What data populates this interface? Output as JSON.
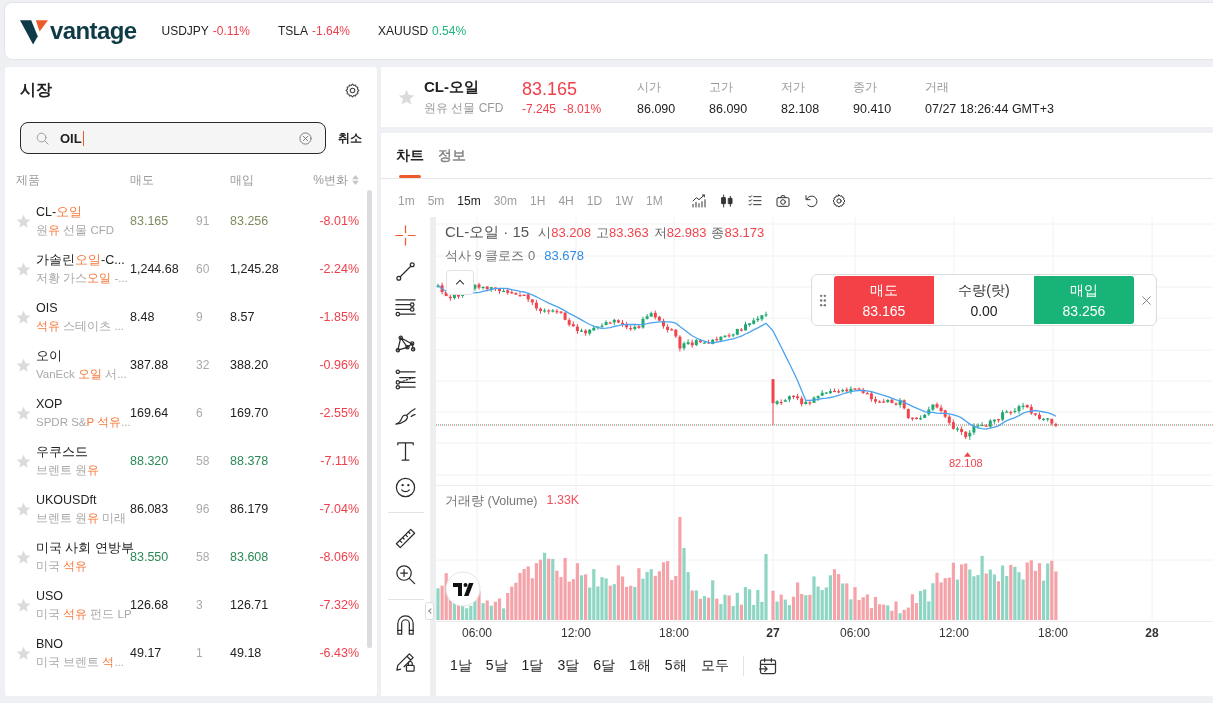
{
  "top_bar": {
    "logo": "vantage",
    "tickers": [
      {
        "symbol": "USDJPY",
        "change": "-0.11%",
        "falling": true
      },
      {
        "symbol": "TSLA",
        "change": "-1.64%",
        "falling": true
      },
      {
        "symbol": "XAUUSD",
        "change": "0.54%",
        "falling": false
      }
    ]
  },
  "market": {
    "title": "시장",
    "search": {
      "value": "OIL",
      "focused": true
    },
    "cancel": "취소",
    "columns": [
      {
        "label": "제품",
        "sortable": false
      },
      {
        "label": "매도",
        "sortable": false
      },
      {
        "label": "매입",
        "sortable": false
      },
      {
        "label": "%변화",
        "sortable": true
      }
    ],
    "rows": [
      {
        "symbol": [
          {
            "text": "CL-",
            "match": false
          },
          {
            "text": "오일",
            "match": true
          }
        ],
        "description": [
          {
            "text": "원",
            "match": false
          },
          {
            "text": "유",
            "match": true
          },
          {
            "text": " 선물 CFD",
            "match": false
          }
        ],
        "favorite": false,
        "bid": "83.165",
        "spread": "91",
        "ask": "83.256",
        "change": "-8.01%",
        "falling": true,
        "color": "#7d8c5e"
      },
      {
        "symbol": [
          {
            "text": "가솔린",
            "match": false
          },
          {
            "text": "오일",
            "match": true
          },
          {
            "text": "-C...",
            "match": false
          }
        ],
        "description": [
          {
            "text": "저황 가스",
            "match": false
          },
          {
            "text": "오일",
            "match": true
          },
          {
            "text": " -...",
            "match": false
          }
        ],
        "favorite": false,
        "bid": "1,244.68",
        "spread": "60",
        "ask": "1,245.28",
        "change": "-2.24%",
        "falling": true,
        "color": "#222222"
      },
      {
        "symbol": [
          {
            "text": "OIS",
            "match": false
          }
        ],
        "description": [
          {
            "text": "석유",
            "match": true
          },
          {
            "text": " 스테이츠 ...",
            "match": false
          }
        ],
        "favorite": false,
        "bid": "8.48",
        "spread": "9",
        "ask": "8.57",
        "change": "-1.85%",
        "falling": true,
        "color": "#222222"
      },
      {
        "symbol": [
          {
            "text": "오이",
            "match": false
          }
        ],
        "description": [
          {
            "text": "VanEck ",
            "match": false
          },
          {
            "text": "오일",
            "match": true
          },
          {
            "text": " 서...",
            "match": false
          }
        ],
        "favorite": false,
        "bid": "387.88",
        "spread": "32",
        "ask": "388.20",
        "change": "-0.96%",
        "falling": true,
        "color": "#222222"
      },
      {
        "symbol": [
          {
            "text": "XOP",
            "match": false
          }
        ],
        "description": [
          {
            "text": "SPDR S&",
            "match": false
          },
          {
            "text": "P 석유",
            "match": true
          },
          {
            "text": "...",
            "match": false
          }
        ],
        "favorite": false,
        "bid": "169.64",
        "spread": "6",
        "ask": "169.70",
        "change": "-2.55%",
        "falling": true,
        "color": "#222222"
      },
      {
        "symbol": [
          {
            "text": "우쿠스드",
            "match": false
          }
        ],
        "description": [
          {
            "text": "브렌트 원",
            "match": false
          },
          {
            "text": "유",
            "match": true
          }
        ],
        "favorite": false,
        "bid": "88.320",
        "spread": "58",
        "ask": "88.378",
        "change": "-7.11%",
        "falling": true,
        "color": "#2a8a55"
      },
      {
        "symbol": [
          {
            "text": "UKOUSDft",
            "match": false
          }
        ],
        "description": [
          {
            "text": "브렌트 원",
            "match": false
          },
          {
            "text": "유",
            "match": true
          },
          {
            "text": " 미래",
            "match": false
          }
        ],
        "favorite": false,
        "bid": "86.083",
        "spread": "96",
        "ask": "86.179",
        "change": "-7.04%",
        "falling": true,
        "color": "#222222"
      },
      {
        "symbol": [
          {
            "text": "미국 사회 연방부",
            "match": false
          }
        ],
        "description": [
          {
            "text": "미국 ",
            "match": false
          },
          {
            "text": "석유",
            "match": true
          }
        ],
        "favorite": false,
        "bid": "83.550",
        "spread": "58",
        "ask": "83.608",
        "change": "-8.06%",
        "falling": true,
        "color": "#2a8a55"
      },
      {
        "symbol": [
          {
            "text": "USO",
            "match": false
          }
        ],
        "description": [
          {
            "text": "미국 ",
            "match": false
          },
          {
            "text": "석유",
            "match": true
          },
          {
            "text": " 펀드 LP",
            "match": false
          }
        ],
        "favorite": false,
        "bid": "126.68",
        "spread": "3",
        "ask": "126.71",
        "change": "-7.32%",
        "falling": true,
        "color": "#222222"
      },
      {
        "symbol": [
          {
            "text": "BNO",
            "match": false
          }
        ],
        "description": [
          {
            "text": "미국 브렌트 ",
            "match": false
          },
          {
            "text": "석",
            "match": true
          },
          {
            "text": "...",
            "match": false
          }
        ],
        "favorite": false,
        "bid": "49.17",
        "spread": "1",
        "ask": "49.18",
        "change": "-6.43%",
        "falling": true,
        "color": "#222222"
      }
    ]
  },
  "instrument": {
    "favorite": false,
    "symbol": "CL-오일",
    "description": "원유 선물 CFD",
    "price": "83.165",
    "change": "-7.245",
    "change_percent": "-8.01%",
    "falling": true,
    "stats": [
      {
        "label": "시가",
        "value": "86.090"
      },
      {
        "label": "고가",
        "value": "86.090"
      },
      {
        "label": "저가",
        "value": "82.108"
      },
      {
        "label": "종가",
        "value": "90.410"
      },
      {
        "label": "거래",
        "value": "07/27 18:26:44 GMT+3"
      }
    ]
  },
  "chart_panel": {
    "tabs": [
      {
        "label": "차트",
        "selected": true
      },
      {
        "label": "정보",
        "selected": false
      }
    ],
    "intervals": [
      {
        "label": "1m",
        "selected": false
      },
      {
        "label": "5m",
        "selected": false
      },
      {
        "label": "15m",
        "selected": true
      },
      {
        "label": "30m",
        "selected": false
      },
      {
        "label": "1H",
        "selected": false
      },
      {
        "label": "4H",
        "selected": false
      },
      {
        "label": "1D",
        "selected": false
      },
      {
        "label": "1W",
        "selected": false
      },
      {
        "label": "1M",
        "selected": false
      }
    ],
    "legend": {
      "title": "CL-오일 · 15",
      "ohlc": [
        {
          "label": "시",
          "value": "83.208"
        },
        {
          "label": "고",
          "value": "83.363"
        },
        {
          "label": "저",
          "value": "82.983"
        },
        {
          "label": "종",
          "value": "83.173"
        }
      ],
      "indicator": "석사 9 클로즈 0",
      "indicator_value": "83.678"
    },
    "trade": {
      "sell_label": "매도",
      "sell_price": "83.165",
      "quantity_label": "수량(랏)",
      "quantity": "0.00",
      "buy_label": "매입",
      "buy_price": "83.256"
    },
    "low_label": "82.108",
    "volume": {
      "label": "거래량 (Volume)",
      "value": "1.33K"
    },
    "time_axis": [
      {
        "label": "06:00",
        "kind": "time"
      },
      {
        "label": "12:00",
        "kind": "time"
      },
      {
        "label": "18:00",
        "kind": "time"
      },
      {
        "label": "27",
        "kind": "day"
      },
      {
        "label": "06:00",
        "kind": "time"
      },
      {
        "label": "12:00",
        "kind": "time"
      },
      {
        "label": "18:00",
        "kind": "time"
      },
      {
        "label": "28",
        "kind": "day"
      }
    ],
    "ranges": [
      "1날",
      "5날",
      "1달",
      "3달",
      "6달",
      "1해",
      "5해",
      "모두"
    ]
  }
}
